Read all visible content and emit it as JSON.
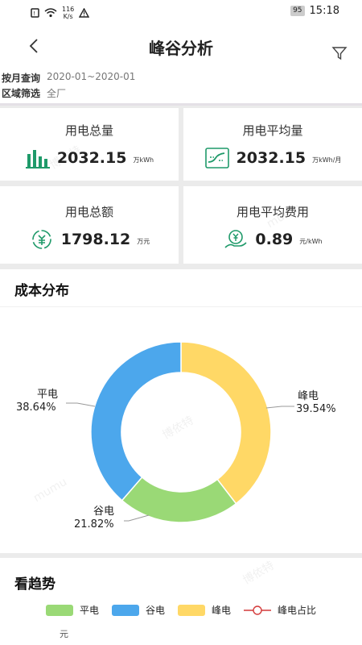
{
  "status": {
    "network_speed": "116",
    "network_unit": "K/s",
    "battery": "95",
    "time": "15:18"
  },
  "header": {
    "title": "峰谷分析"
  },
  "filters": {
    "month_label": "按月查询",
    "month_value": "2020-01~2020-01",
    "area_label": "区域筛选",
    "area_value": "全厂"
  },
  "cards": [
    {
      "title": "用电总量",
      "value": "2032.15",
      "unit": "万kWh",
      "icon": "bar-chart-icon"
    },
    {
      "title": "用电平均量",
      "value": "2032.15",
      "unit": "万kWh/月",
      "icon": "line-trend-icon"
    },
    {
      "title": "用电总额",
      "value": "1798.12",
      "unit": "万元",
      "icon": "money-cycle-icon"
    },
    {
      "title": "用电平均费用",
      "value": "0.89",
      "unit": "元/kWh",
      "icon": "yen-hand-icon"
    }
  ],
  "cost_section": {
    "title": "成本分布"
  },
  "chart_data": {
    "type": "pie",
    "variant": "donut",
    "slices": [
      {
        "name": "峰电",
        "value": 39.54,
        "label": "39.54%",
        "color": "#ffd866"
      },
      {
        "name": "谷电",
        "value": 21.82,
        "label": "21.82%",
        "color": "#9ad976"
      },
      {
        "name": "平电",
        "value": 38.64,
        "label": "38.64%",
        "color": "#4ca7ec"
      }
    ]
  },
  "trend_section": {
    "title": "看趋势",
    "legend": [
      {
        "name": "平电",
        "color": "#9ad976",
        "kind": "bar"
      },
      {
        "name": "谷电",
        "color": "#4ca7ec",
        "kind": "bar"
      },
      {
        "name": "峰电",
        "color": "#ffd866",
        "kind": "bar"
      },
      {
        "name": "峰电占比",
        "color": "#d43a3a",
        "kind": "line"
      }
    ],
    "y_unit": "元"
  },
  "watermark": {
    "a": "博依特",
    "b": "mumu"
  }
}
